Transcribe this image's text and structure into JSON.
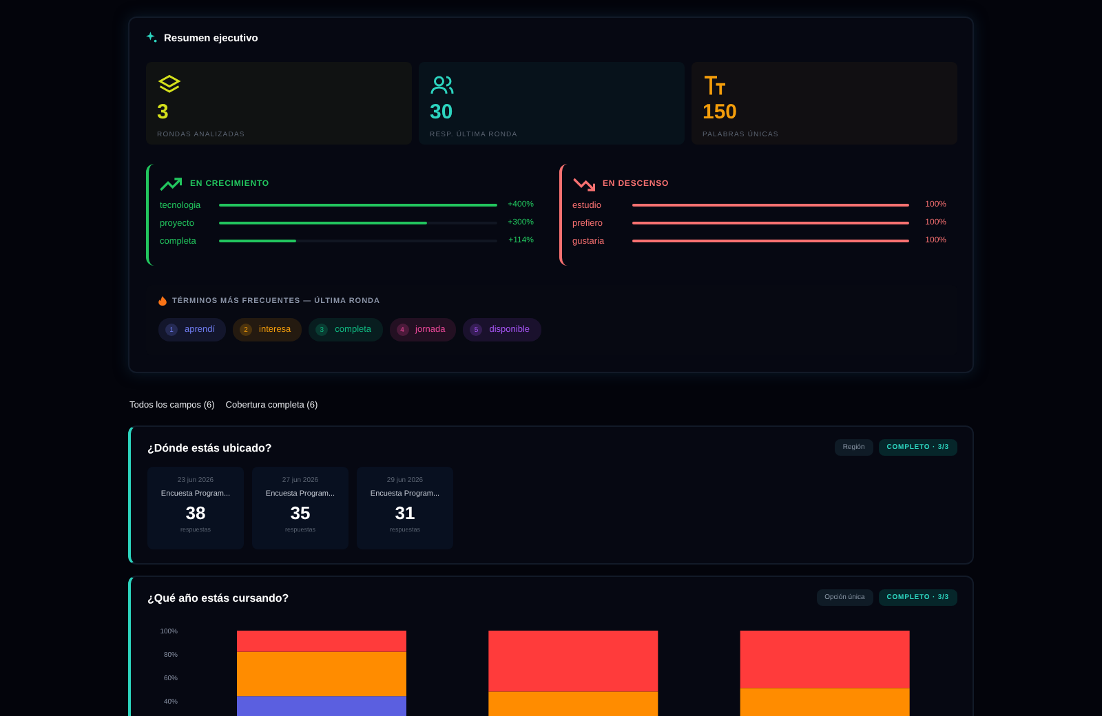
{
  "summary": {
    "title": "Resumen ejecutivo",
    "stats": [
      {
        "kind": "layers",
        "value": "3",
        "label": "RONDAS ANALIZADAS",
        "color": "#d4e01c"
      },
      {
        "kind": "users",
        "value": "30",
        "label": "RESP. ÚLTIMA RONDA",
        "color": "#2dd4bf"
      },
      {
        "kind": "text",
        "value": "150",
        "label": "PALABRAS ÚNICAS",
        "color": "#f59e0b"
      }
    ],
    "trends": [
      {
        "kind": "up",
        "title": "EN CRECIMIENTO",
        "items": [
          {
            "term": "tecnologia",
            "level": 1,
            "reading": "+400%"
          },
          {
            "term": "proyecto",
            "level": 0.75,
            "reading": "+300%"
          },
          {
            "term": "completa",
            "level": 0.28,
            "reading": "+114%"
          }
        ]
      },
      {
        "kind": "down",
        "title": "EN DESCENSO",
        "items": [
          {
            "term": "estudio",
            "level": 1,
            "reading": "100%"
          },
          {
            "term": "prefiero",
            "level": 1,
            "reading": "100%"
          },
          {
            "term": "gustaria",
            "level": 1,
            "reading": "100%"
          }
        ]
      }
    ],
    "terms": {
      "title": "TÉRMINOS MÁS FRECUENTES — ÚLTIMA RONDA",
      "chips": [
        {
          "rank": "1",
          "word": "aprendí",
          "color": "#6f7cf0"
        },
        {
          "rank": "2",
          "word": "interesa",
          "color": "#f59e0b"
        },
        {
          "rank": "3",
          "word": "completa",
          "color": "#10b981"
        },
        {
          "rank": "4",
          "word": "jornada",
          "color": "#ec4899"
        },
        {
          "rank": "5",
          "word": "disponible",
          "color": "#a855f7"
        }
      ]
    }
  },
  "tabs": [
    {
      "label": "Todos los campos (6)"
    },
    {
      "label": "Cobertura completa (6)"
    }
  ],
  "questions": [
    {
      "kind": "rounds",
      "title": "¿Dónde estás ubicado?",
      "tags": [
        {
          "kind": "type",
          "text": "Región"
        },
        {
          "kind": "status",
          "text": "COMPLETO · 3/3"
        }
      ],
      "rounds": [
        {
          "date": "23 jun 2026",
          "name": "Encuesta Program...",
          "count": "38",
          "unit": "respuestas"
        },
        {
          "date": "27 jun 2026",
          "name": "Encuesta Program...",
          "count": "35",
          "unit": "respuestas"
        },
        {
          "date": "29 jun 2026",
          "name": "Encuesta Program...",
          "count": "31",
          "unit": "respuestas"
        }
      ]
    },
    {
      "kind": "chart",
      "title": "¿Qué año estás cursando?",
      "tags": [
        {
          "kind": "type",
          "text": "Opción única"
        },
        {
          "kind": "status",
          "text": "COMPLETO · 3/3"
        }
      ],
      "chart_data": {
        "type": "bar",
        "stacked": true,
        "ylim": [
          0,
          100
        ],
        "yticks": [
          {
            "value": 100,
            "label": "100%"
          },
          {
            "value": 80,
            "label": "80%"
          },
          {
            "value": 60,
            "label": "60%"
          },
          {
            "value": 40,
            "label": "40%"
          }
        ],
        "series": [
          {
            "color": "#5b5fe0",
            "values": [
              44,
              0,
              0
            ]
          },
          {
            "color": "#ff8c00",
            "values": [
              38,
              48,
              51
            ]
          },
          {
            "color": "#ff3b3b",
            "values": [
              18,
              52,
              49
            ]
          }
        ]
      }
    }
  ]
}
